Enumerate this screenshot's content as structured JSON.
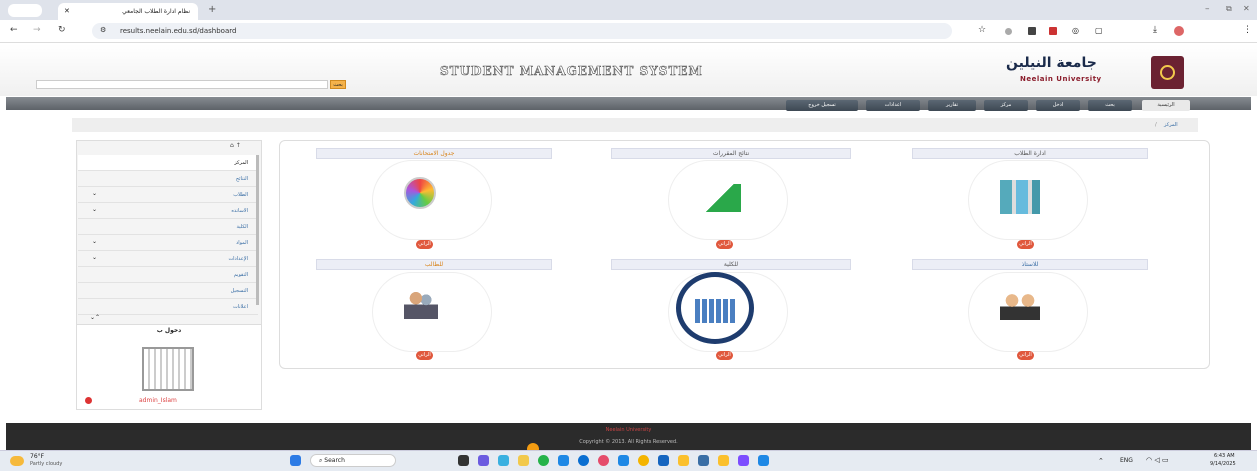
{
  "browser": {
    "tab_title": "نظام ادارة الطلاب الجامعي",
    "url": "results.neelain.edu.sd/dashboard"
  },
  "header": {
    "banner_title": "STUDENT MANAGEMENT SYSTEM",
    "search_button": "بحث",
    "logo_arabic": "جامعة النيلين",
    "logo_english": "Neelain University"
  },
  "nav": {
    "items": [
      "الرئيسية",
      "بحث",
      "ادخل",
      "مركز",
      "تقارير",
      "اعدادات",
      "تسجيل خروج"
    ]
  },
  "breadcrumb": {
    "home": "المركز",
    "separator": "/"
  },
  "sidebar": {
    "items": [
      {
        "label": "المركز"
      },
      {
        "label": "النتائج"
      },
      {
        "label": "الطلاب"
      },
      {
        "label": "الاساتذه"
      },
      {
        "label": "الكلية"
      },
      {
        "label": "المواد"
      },
      {
        "label": "الإعدادات"
      },
      {
        "label": "التقويم"
      },
      {
        "label": "التسجيل"
      },
      {
        "label": "اعلانات"
      }
    ],
    "login_title": "دخول ب",
    "username": "admin_Islam"
  },
  "cards": [
    {
      "title": "ادارة الطلاب",
      "button": "الراتي",
      "icon": "folders-icon"
    },
    {
      "title": "نتائج المقررات",
      "button": "الراتي",
      "icon": "chart-icon"
    },
    {
      "title": "جدول الامتحانات",
      "button": "الراتي",
      "icon": "clock-icon"
    },
    {
      "title": "للاستاذ",
      "button": "الراتي",
      "icon": "teachers-icon"
    },
    {
      "title": "للكلية",
      "button": "الراتي",
      "icon": "building-icon"
    },
    {
      "title": "للطالب",
      "button": "الراتي",
      "icon": "student-icon"
    }
  ],
  "footer": {
    "university": "Neelain University",
    "copyright": "Copyright © 2013. All Rights Reserved."
  },
  "taskbar": {
    "weather_temp": "76°F",
    "weather_desc": "Partly cloudy",
    "search_placeholder": "Search",
    "lang": "ENG",
    "time": "6:43 AM",
    "date": "9/14/2025"
  }
}
